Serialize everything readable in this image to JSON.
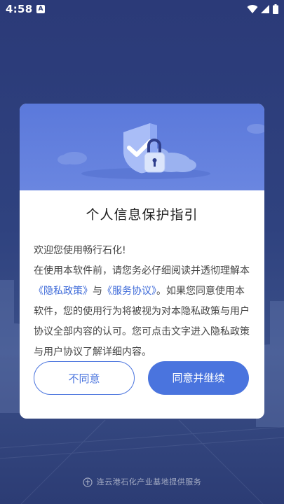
{
  "status_bar": {
    "time": "4:58",
    "notification_icon": "A",
    "icons": [
      "wifi-icon",
      "signal-icon",
      "battery-icon"
    ]
  },
  "dialog": {
    "title": "个人信息保护指引",
    "body": {
      "line1": "欢迎您使用畅行石化!",
      "para_pre": "在使用本软件前，请您务必仔细阅读并透彻理解本",
      "privacy_link": "《隐私政策》",
      "para_and": "与",
      "service_link": "《服务协议》",
      "para_post": "。如果您同意使用本软件，您的使用行为将被视为对本隐私政策与用户协议全部内容的认可。您可点击文字进入隐私政策与用户协议了解详细内容。"
    },
    "decline_label": "不同意",
    "accept_label": "同意并继续"
  },
  "footer": {
    "text": "连云港石化产业基地提供服务"
  },
  "colors": {
    "primary": "#4a74de",
    "hero": "#5b79db",
    "background": "#2f427f"
  }
}
